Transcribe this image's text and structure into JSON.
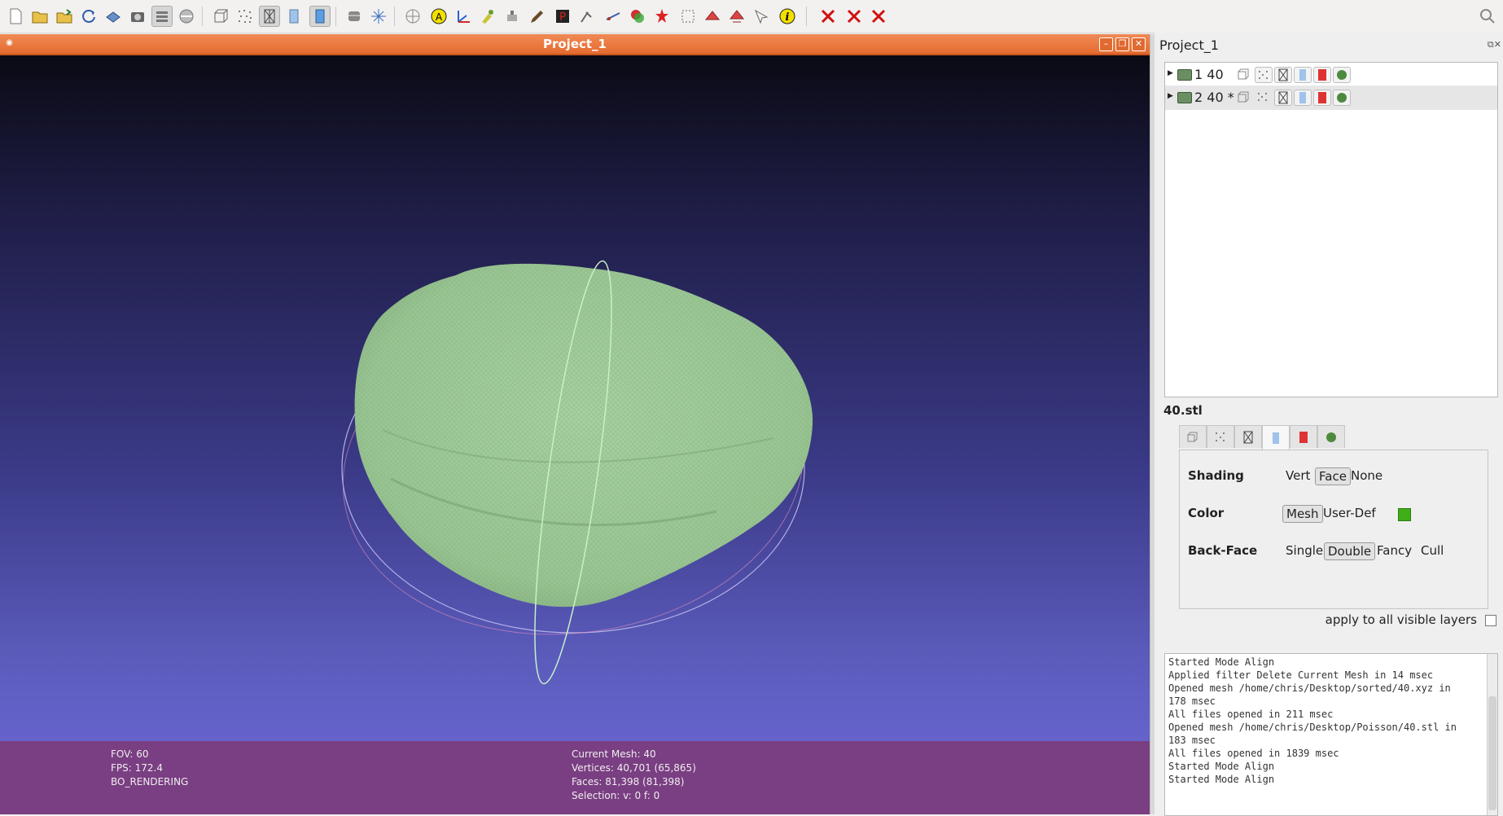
{
  "toolbar": {
    "buttons": [
      "new-project",
      "open-project",
      "import-mesh",
      "reload",
      "export-mesh",
      "snapshot",
      "layers",
      "bounding-box",
      "points",
      "wireframe",
      "flat-lines",
      "smooth",
      "light",
      "trackball",
      "texture",
      "annotation",
      "axis",
      "paint",
      "brush",
      "red-paint",
      "pick",
      "measure",
      "align",
      "georef",
      "select-faces",
      "select-vertices",
      "select-connected",
      "info",
      "delete-faces",
      "delete-vertices",
      "delete-selected"
    ],
    "search_icon": "search"
  },
  "viewer": {
    "title": "Project_1",
    "mesh_color": "#9cc896",
    "hud": {
      "fov": "FOV: 60",
      "fps": "FPS:   172.4",
      "rendering": "BO_RENDERING",
      "current_mesh": "Current Mesh: 40",
      "vertices": "Vertices: 40,701    (65,865)",
      "faces": "Faces: 81,398    (81,398)",
      "selection": "Selection: v: 0 f: 0"
    }
  },
  "panel": {
    "title": "Project_1",
    "layers": [
      {
        "label": "1  40",
        "selected": false
      },
      {
        "label": "2  40 *",
        "selected": true
      }
    ],
    "mesh_name": "40.stl",
    "shading": {
      "label": "Shading",
      "options": [
        "Vert",
        "Face",
        "None"
      ],
      "selected": "Face"
    },
    "color": {
      "label": "Color",
      "options": [
        "Mesh",
        "User-Def"
      ],
      "selected": "Mesh",
      "swatch": "#3fae18"
    },
    "backface": {
      "label": "Back-Face",
      "options": [
        "Single",
        "Double",
        "Fancy",
        "Cull"
      ],
      "selected": "Double"
    },
    "apply_label": "apply to all visible layers",
    "log": [
      "Started Mode Align",
      "Applied filter Delete Current Mesh in 14 msec",
      "Opened mesh /home/chris/Desktop/sorted/40.xyz in",
      "178 msec",
      "All files opened in 211 msec",
      "Opened mesh /home/chris/Desktop/Poisson/40.stl in",
      "183 msec",
      "All files opened in 1839 msec",
      "Started Mode Align",
      "Started Mode Align"
    ]
  }
}
